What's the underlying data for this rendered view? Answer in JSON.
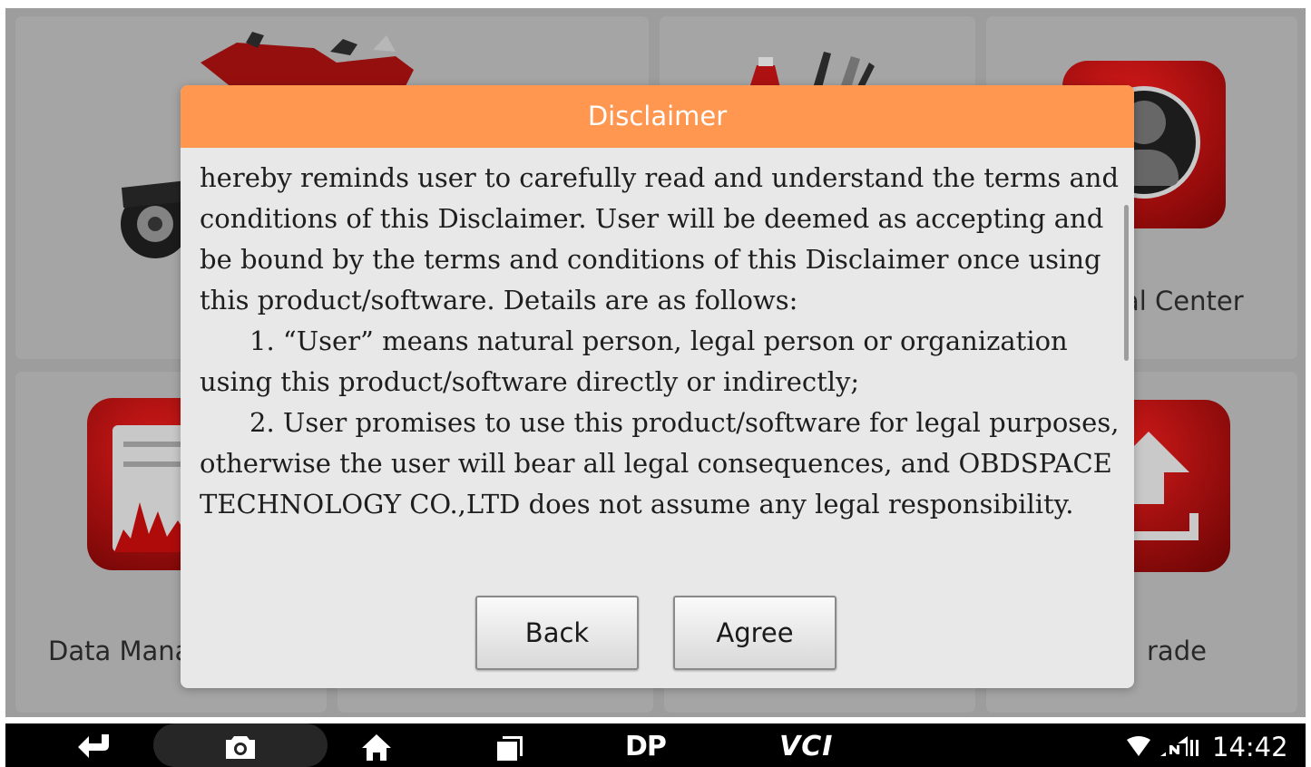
{
  "background_tiles": [
    {
      "name": "vehicle-tile",
      "label": ""
    },
    {
      "name": "tools-tile",
      "label": ""
    },
    {
      "name": "personal-center-tile",
      "label": "al Center"
    },
    {
      "name": "data-manager-tile",
      "label": "Data Mana"
    },
    {
      "name": "blank-tile-1",
      "label": ""
    },
    {
      "name": "blank-tile-2",
      "label": ""
    },
    {
      "name": "upgrade-tile",
      "label": "rade"
    }
  ],
  "dialog": {
    "title": "Disclaimer",
    "paragraphs": [
      "hereby reminds user to carefully read and understand the terms and conditions of this Disclaimer. User will be deemed as accepting and be bound by the terms and conditions of this Disclaimer once using this product/software. Details are as follows:",
      "1. “User” means natural person, legal person or organization using this product/software directly or indirectly;",
      "2. User promises to use this product/software for legal purposes, otherwise the user will bear all legal consequences, and OBDSPACE TECHNOLOGY CO.,LTD does not assume any legal responsibility."
    ],
    "back_label": "Back",
    "agree_label": "Agree"
  },
  "navbar": {
    "dp_label": "DP",
    "vci_label": "VCI",
    "time": "14:42",
    "icons": [
      "back-icon",
      "camera-icon",
      "home-icon",
      "recent-apps-icon",
      "wifi-icon",
      "no-sim-icon"
    ]
  },
  "colors": {
    "dialog_header": "#ff9750",
    "dialog_body": "#e8e8e8",
    "background": "#a3a3a3",
    "tile_accent_red": "#b30d0d"
  }
}
